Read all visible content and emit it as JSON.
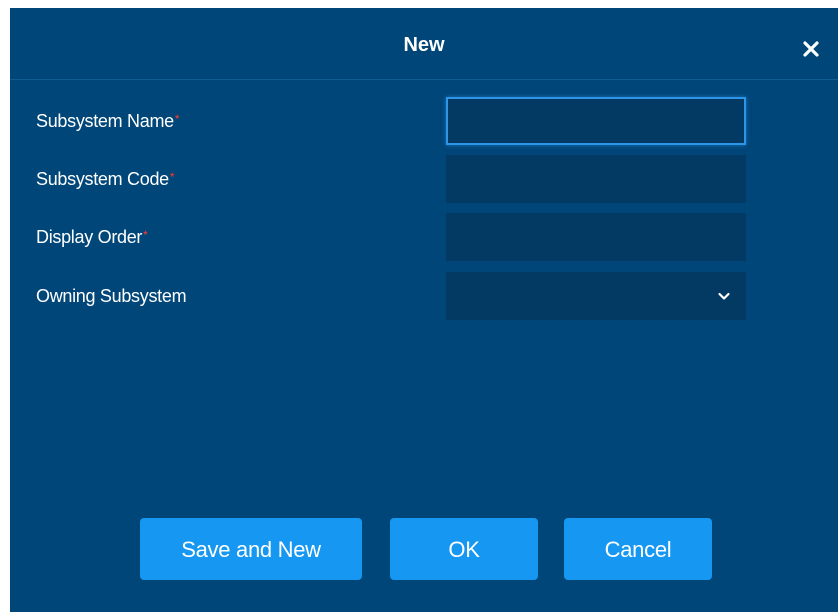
{
  "dialog": {
    "title": "New",
    "close_icon": "close-icon"
  },
  "form": {
    "fields": [
      {
        "label": "Subsystem Name",
        "required": true,
        "required_mark": "*",
        "value": "",
        "type": "text"
      },
      {
        "label": "Subsystem Code",
        "required": true,
        "required_mark": "*",
        "value": "",
        "type": "text"
      },
      {
        "label": "Display Order",
        "required": true,
        "required_mark": "*",
        "value": "",
        "type": "text"
      },
      {
        "label": "Owning Subsystem",
        "required": false,
        "value": "",
        "type": "select"
      }
    ]
  },
  "buttons": {
    "save_and_new": "Save and New",
    "ok": "OK",
    "cancel": "Cancel"
  },
  "colors": {
    "background": "#004679",
    "input_bg": "#033a64",
    "button_bg": "#1597f2",
    "required": "#ff3b30",
    "focus_border": "#2e95e8"
  }
}
